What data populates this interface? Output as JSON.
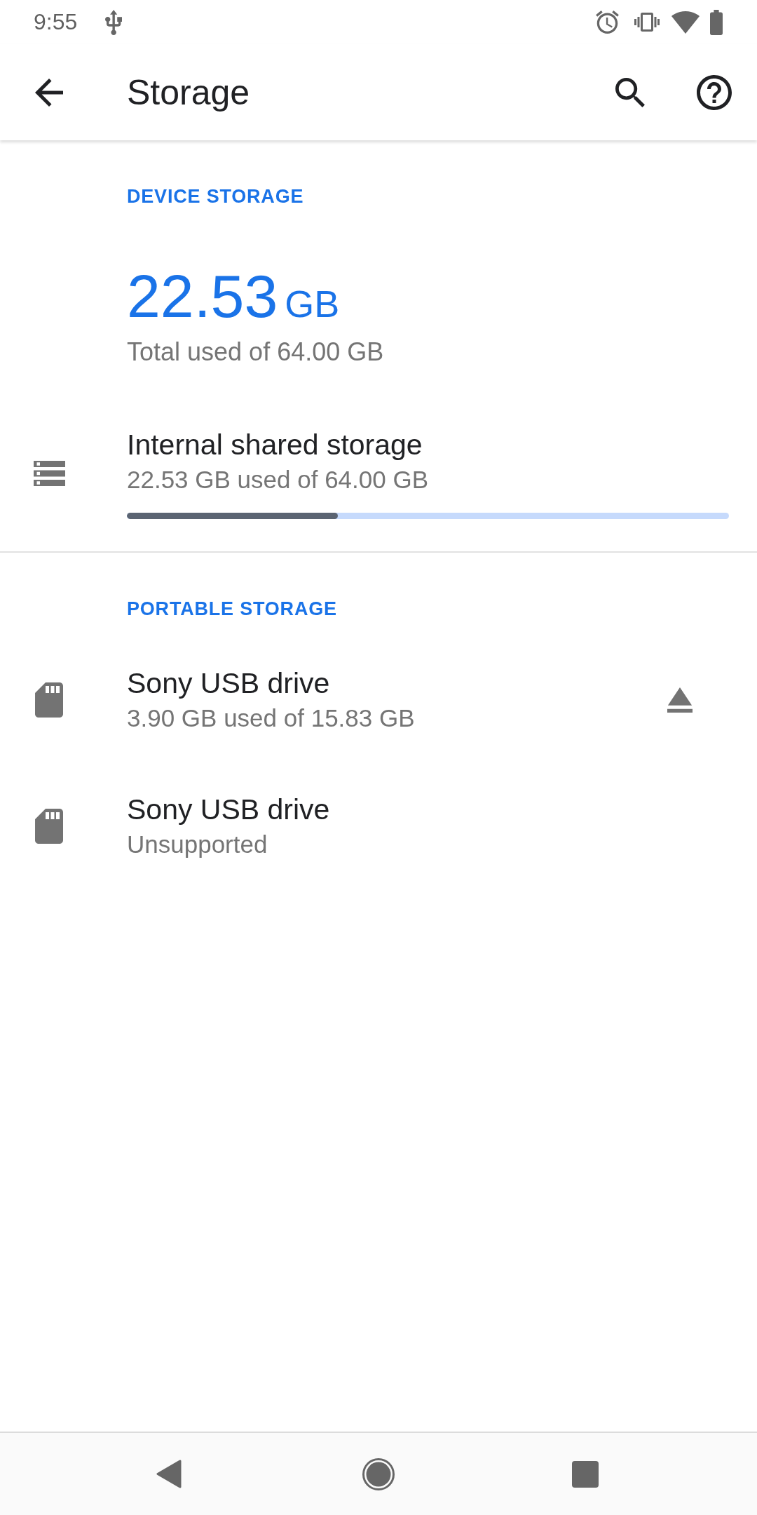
{
  "status_bar": {
    "time": "9:55"
  },
  "app_bar": {
    "title": "Storage"
  },
  "device_storage": {
    "header": "DEVICE STORAGE",
    "total_value": "22.53",
    "total_unit": "GB",
    "total_caption": "Total used of 64.00 GB",
    "volumes": [
      {
        "kind": "internal",
        "title": "Internal shared storage",
        "summary": "22.53 GB used of 64.00 GB",
        "level": 0.35
      }
    ]
  },
  "portable_storage": {
    "header": "PORTABLE STORAGE",
    "volumes": [
      {
        "kind": "sd_card",
        "title": "Sony USB drive",
        "summary": "3.90 GB used of 15.83 GB",
        "ejectable": true
      },
      {
        "kind": "sd_card",
        "title": "Sony USB drive",
        "summary": "Unsupported",
        "ejectable": false
      }
    ]
  }
}
